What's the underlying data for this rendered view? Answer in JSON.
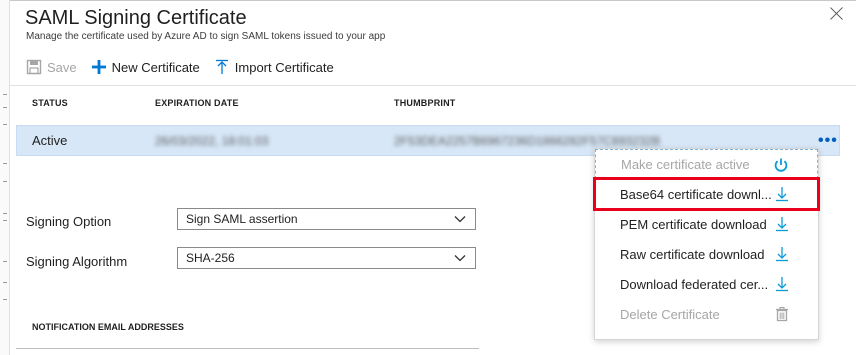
{
  "panel": {
    "title": "SAML Signing Certificate",
    "subtitle": "Manage the certificate used by Azure AD to sign SAML tokens issued to your app"
  },
  "toolbar": {
    "save_label": "Save",
    "new_label": "New Certificate",
    "import_label": "Import Certificate"
  },
  "table": {
    "headers": {
      "status": "STATUS",
      "expiration": "EXPIRATION DATE",
      "thumbprint": "THUMBPRINT"
    },
    "row": {
      "status": "Active",
      "expiration": "26/03/2022, 18:01:03",
      "thumbprint": "2F53DEA2257B6967236D1866282F57C893232B"
    },
    "more_label": "•••"
  },
  "form": {
    "signing_option_label": "Signing Option",
    "signing_option_value": "Sign SAML assertion",
    "signing_algorithm_label": "Signing Algorithm",
    "signing_algorithm_value": "SHA-256"
  },
  "notification": {
    "header": "NOTIFICATION EMAIL ADDRESSES"
  },
  "menu": {
    "items": [
      {
        "label": "Make certificate active",
        "icon": "power-icon",
        "disabled": true
      },
      {
        "label": "Base64 certificate downl...",
        "icon": "download-icon",
        "disabled": false
      },
      {
        "label": "PEM certificate download",
        "icon": "download-icon",
        "disabled": false
      },
      {
        "label": "Raw certificate download",
        "icon": "download-icon",
        "disabled": false
      },
      {
        "label": "Download federated cer...",
        "icon": "download-icon",
        "disabled": false
      },
      {
        "label": "Delete Certificate",
        "icon": "trash-icon",
        "disabled": true
      }
    ]
  },
  "colors": {
    "accent": "#0078d4",
    "selected_row": "#d7e7f7",
    "highlight_box": "#e8001c",
    "disabled_text": "#a6a6a6"
  }
}
